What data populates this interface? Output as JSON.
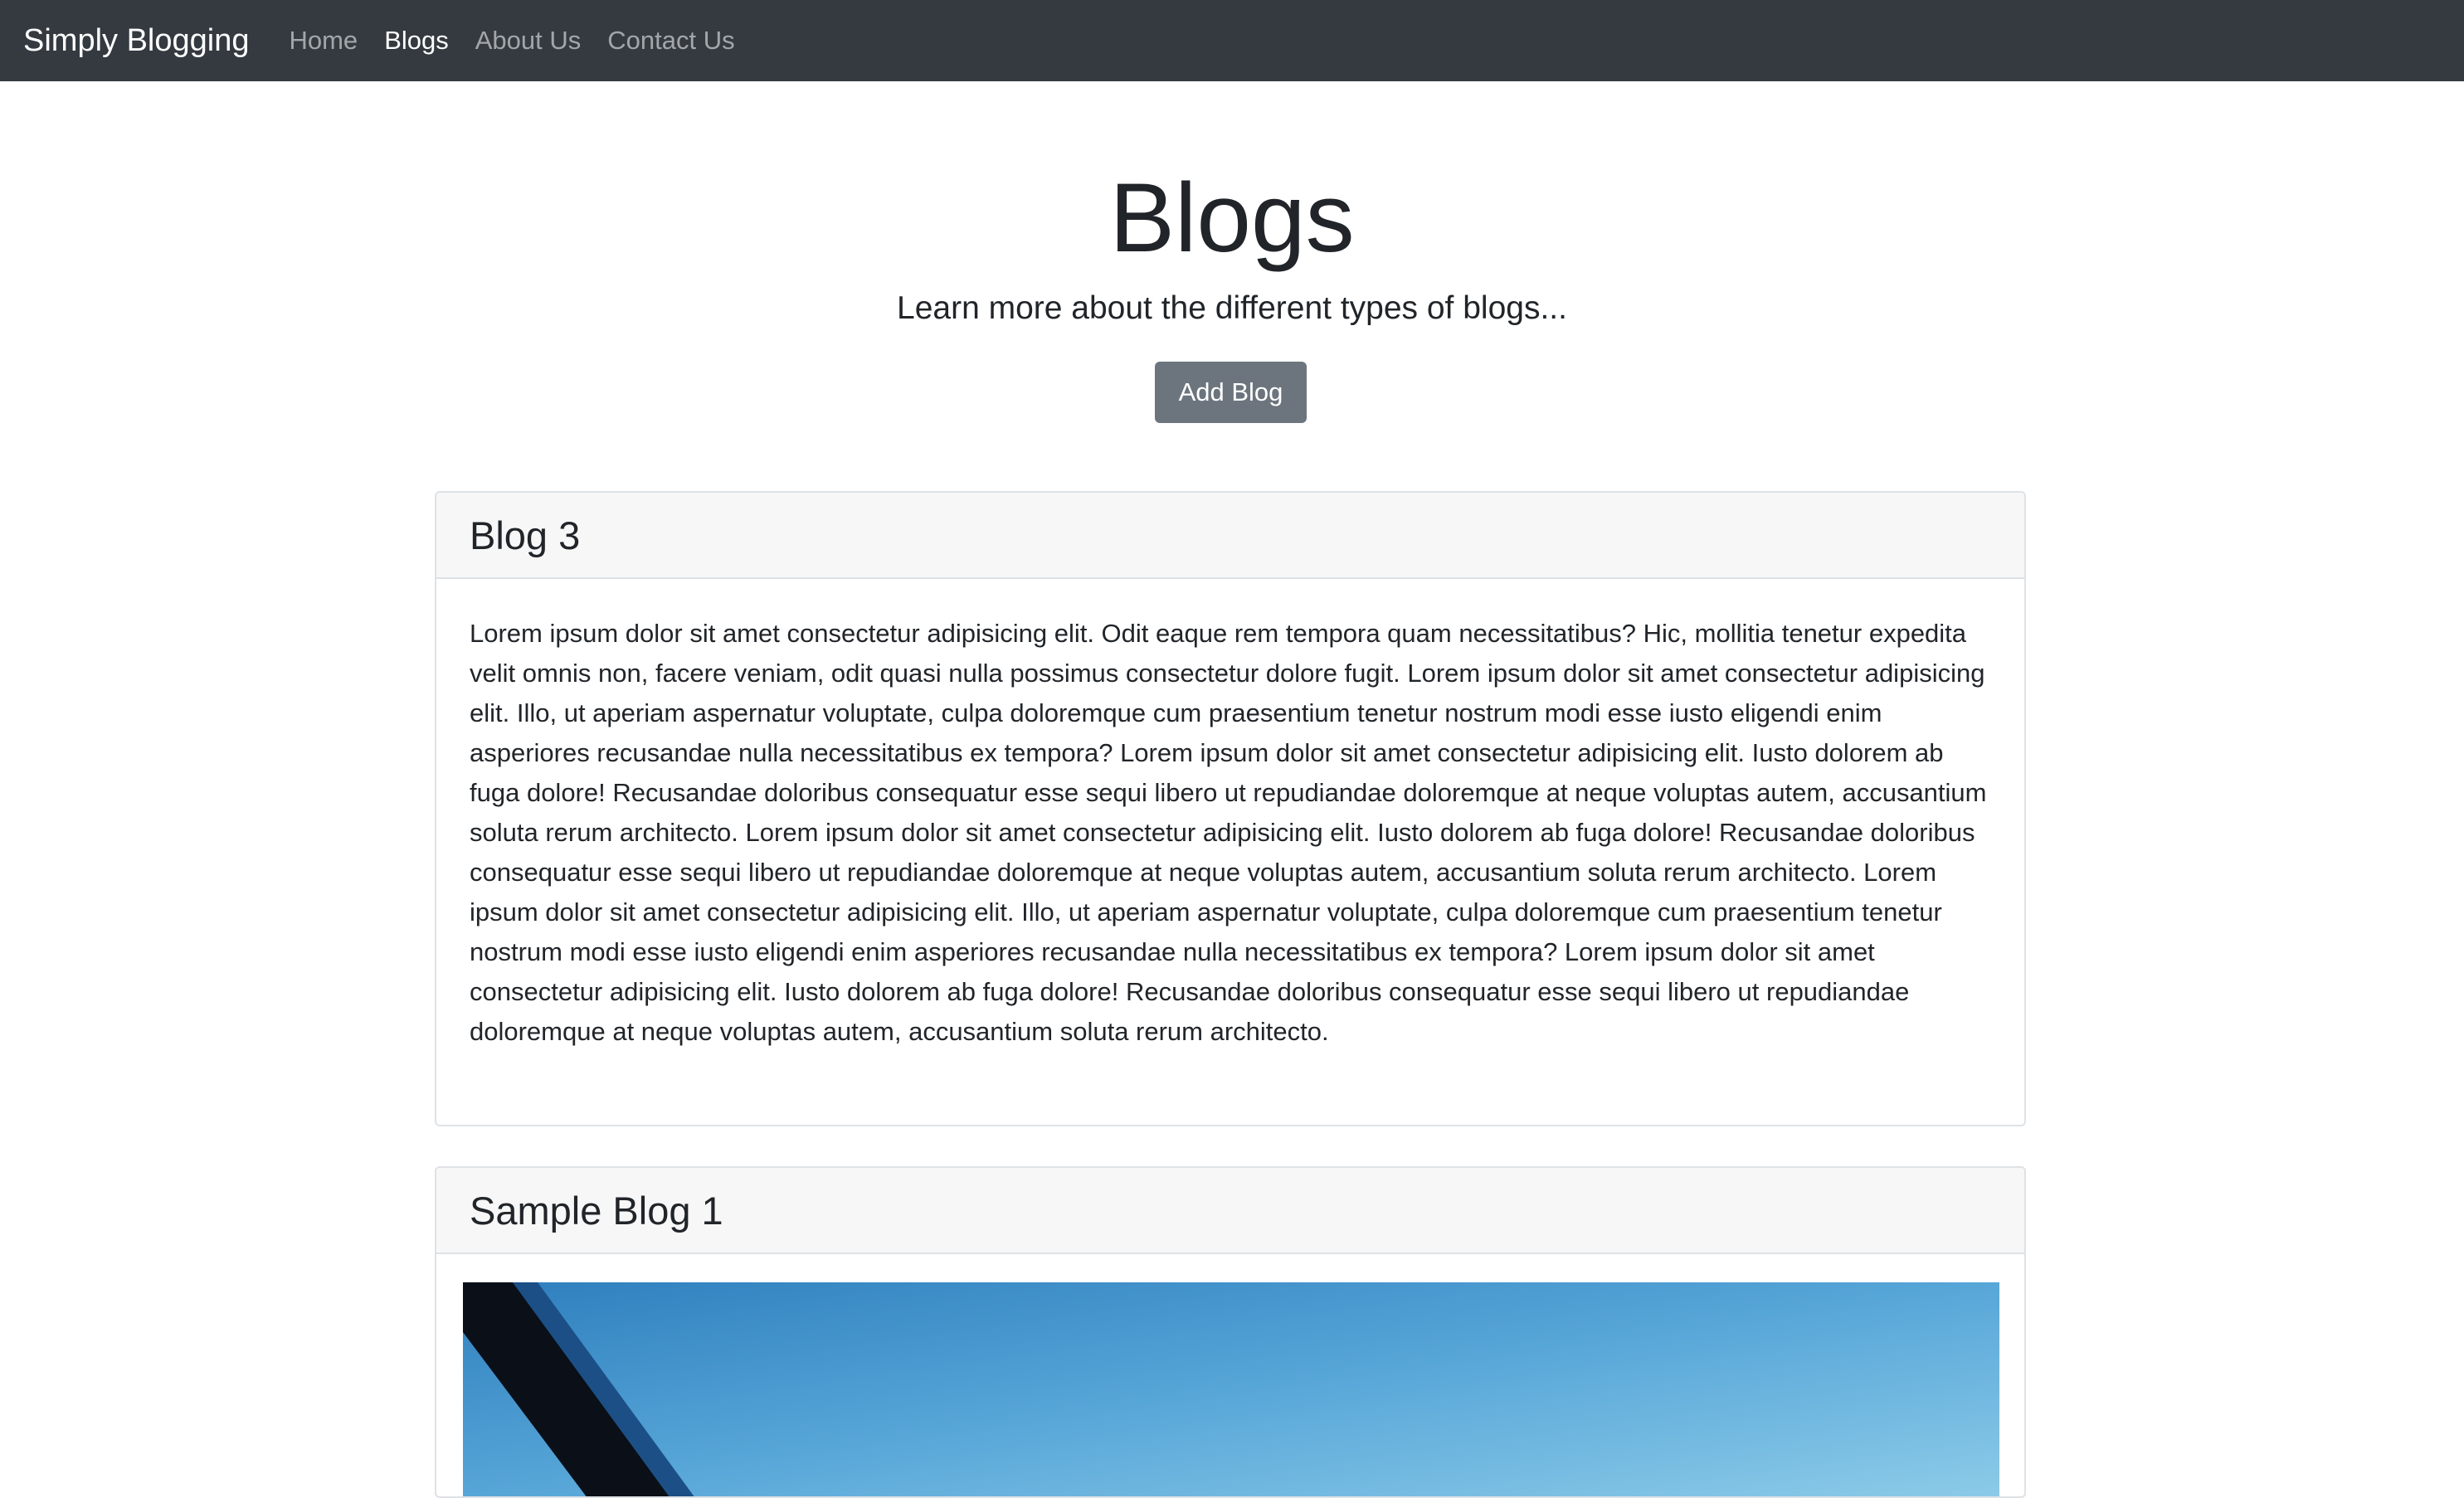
{
  "navbar": {
    "brand": "Simply Blogging",
    "links": [
      {
        "label": "Home",
        "active": false
      },
      {
        "label": "Blogs",
        "active": true
      },
      {
        "label": "About Us",
        "active": false
      },
      {
        "label": "Contact Us",
        "active": false
      }
    ]
  },
  "hero": {
    "title": "Blogs",
    "subtitle": "Learn more about the different types of blogs...",
    "add_button": "Add Blog"
  },
  "blogs": [
    {
      "title": "Blog 3",
      "body": "Lorem ipsum dolor sit amet consectetur adipisicing elit. Odit eaque rem tempora quam necessitatibus? Hic, mollitia tenetur expedita velit omnis non, facere veniam, odit quasi nulla possimus consectetur dolore fugit. Lorem ipsum dolor sit amet consectetur adipisicing elit. Illo, ut aperiam aspernatur voluptate, culpa doloremque cum praesentium tenetur nostrum modi esse iusto eligendi enim asperiores recusandae nulla necessitatibus ex tempora? Lorem ipsum dolor sit amet consectetur adipisicing elit. Iusto dolorem ab fuga dolore! Recusandae doloribus consequatur esse sequi libero ut repudiandae doloremque at neque voluptas autem, accusantium soluta rerum architecto. Lorem ipsum dolor sit amet consectetur adipisicing elit. Iusto dolorem ab fuga dolore! Recusandae doloribus consequatur esse sequi libero ut repudiandae doloremque at neque voluptas autem, accusantium soluta rerum architecto. Lorem ipsum dolor sit amet consectetur adipisicing elit. Illo, ut aperiam aspernatur voluptate, culpa doloremque cum praesentium tenetur nostrum modi esse iusto eligendi enim asperiores recusandae nulla necessitatibus ex tempora? Lorem ipsum dolor sit amet consectetur adipisicing elit. Iusto dolorem ab fuga dolore! Recusandae doloribus consequatur esse sequi libero ut repudiandae doloremque at neque voluptas autem, accusantium soluta rerum architecto."
    },
    {
      "title": "Sample Blog 1"
    }
  ],
  "colors": {
    "navbar_bg": "#343a40",
    "button_bg": "#6c757d",
    "card_header_bg": "#f7f7f7"
  }
}
